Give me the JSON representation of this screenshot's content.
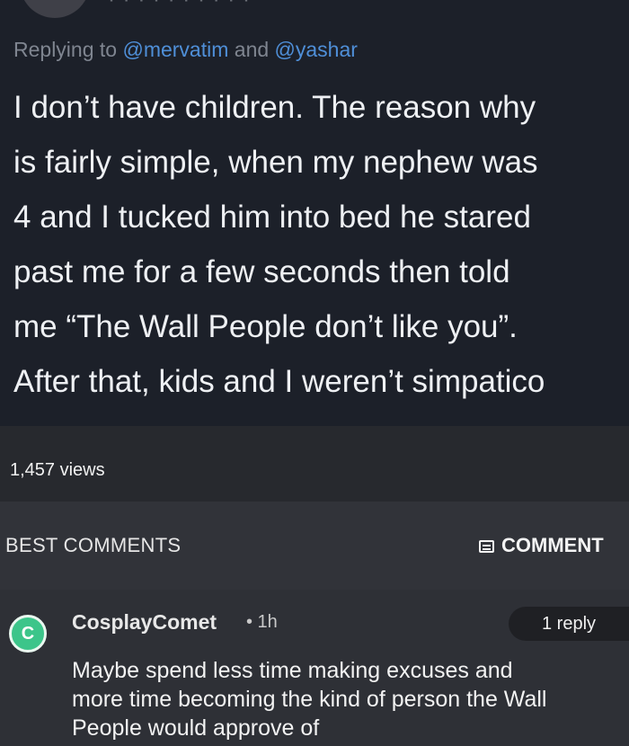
{
  "tweet": {
    "reply_prefix": "Replying to ",
    "mention_1": "@mervatim",
    "mention_join": " and ",
    "mention_2": "@yashar",
    "text_lines": [
      "I don’t have children. The reason why",
      "is fairly simple, when my nephew was",
      "4 and I tucked him into bed he stared",
      "past me for a few seconds then told",
      "me “The Wall People don’t like you”.",
      "After that, kids and I weren’t simpatico"
    ],
    "views": "1,457 views"
  },
  "comments_section": {
    "header": "BEST COMMENTS",
    "comment_button_label": "COMMENT"
  },
  "comment": {
    "avatar_letter": "C",
    "username": "CosplayComet",
    "time": "• 1h",
    "reply_count": "1 reply",
    "text_lines": [
      "Maybe spend less time making excuses and",
      "more time becoming the kind of person the Wall",
      "People would approve of"
    ]
  },
  "colors": {
    "tweet_bg": "#1c2029",
    "mention": "#4f8fd8",
    "avatar_green": "#3cc58a"
  }
}
